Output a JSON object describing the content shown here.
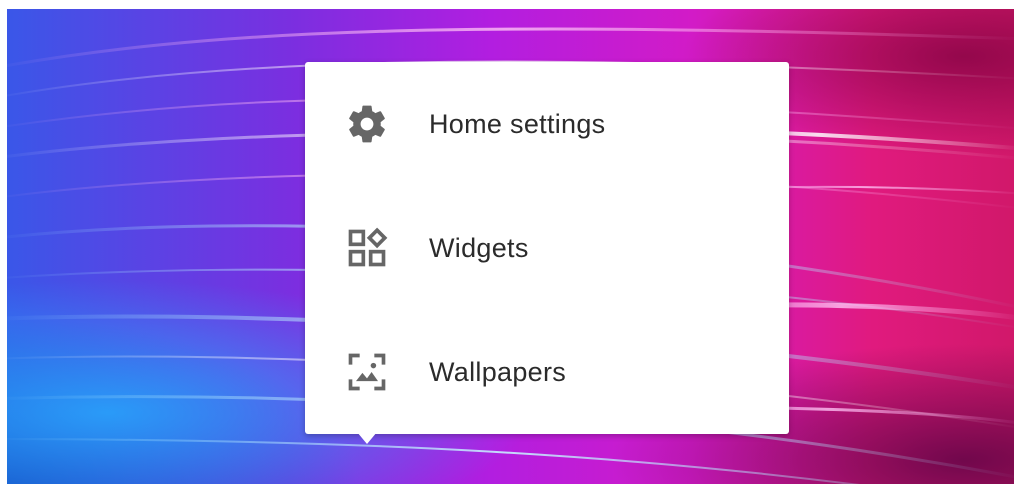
{
  "wallpaper": {
    "colors": [
      "#3a57e8",
      "#7a2fe0",
      "#b21ee0",
      "#d21bc7",
      "#e01a7e"
    ]
  },
  "context_menu": {
    "items": [
      {
        "label": "Home settings",
        "icon": "gear-icon"
      },
      {
        "label": "Widgets",
        "icon": "widgets-icon"
      },
      {
        "label": "Wallpapers",
        "icon": "wallpaper-icon"
      }
    ]
  },
  "colors": {
    "menu_background": "#ffffff",
    "label_text": "#2b2b2b",
    "icon": "#666666"
  }
}
